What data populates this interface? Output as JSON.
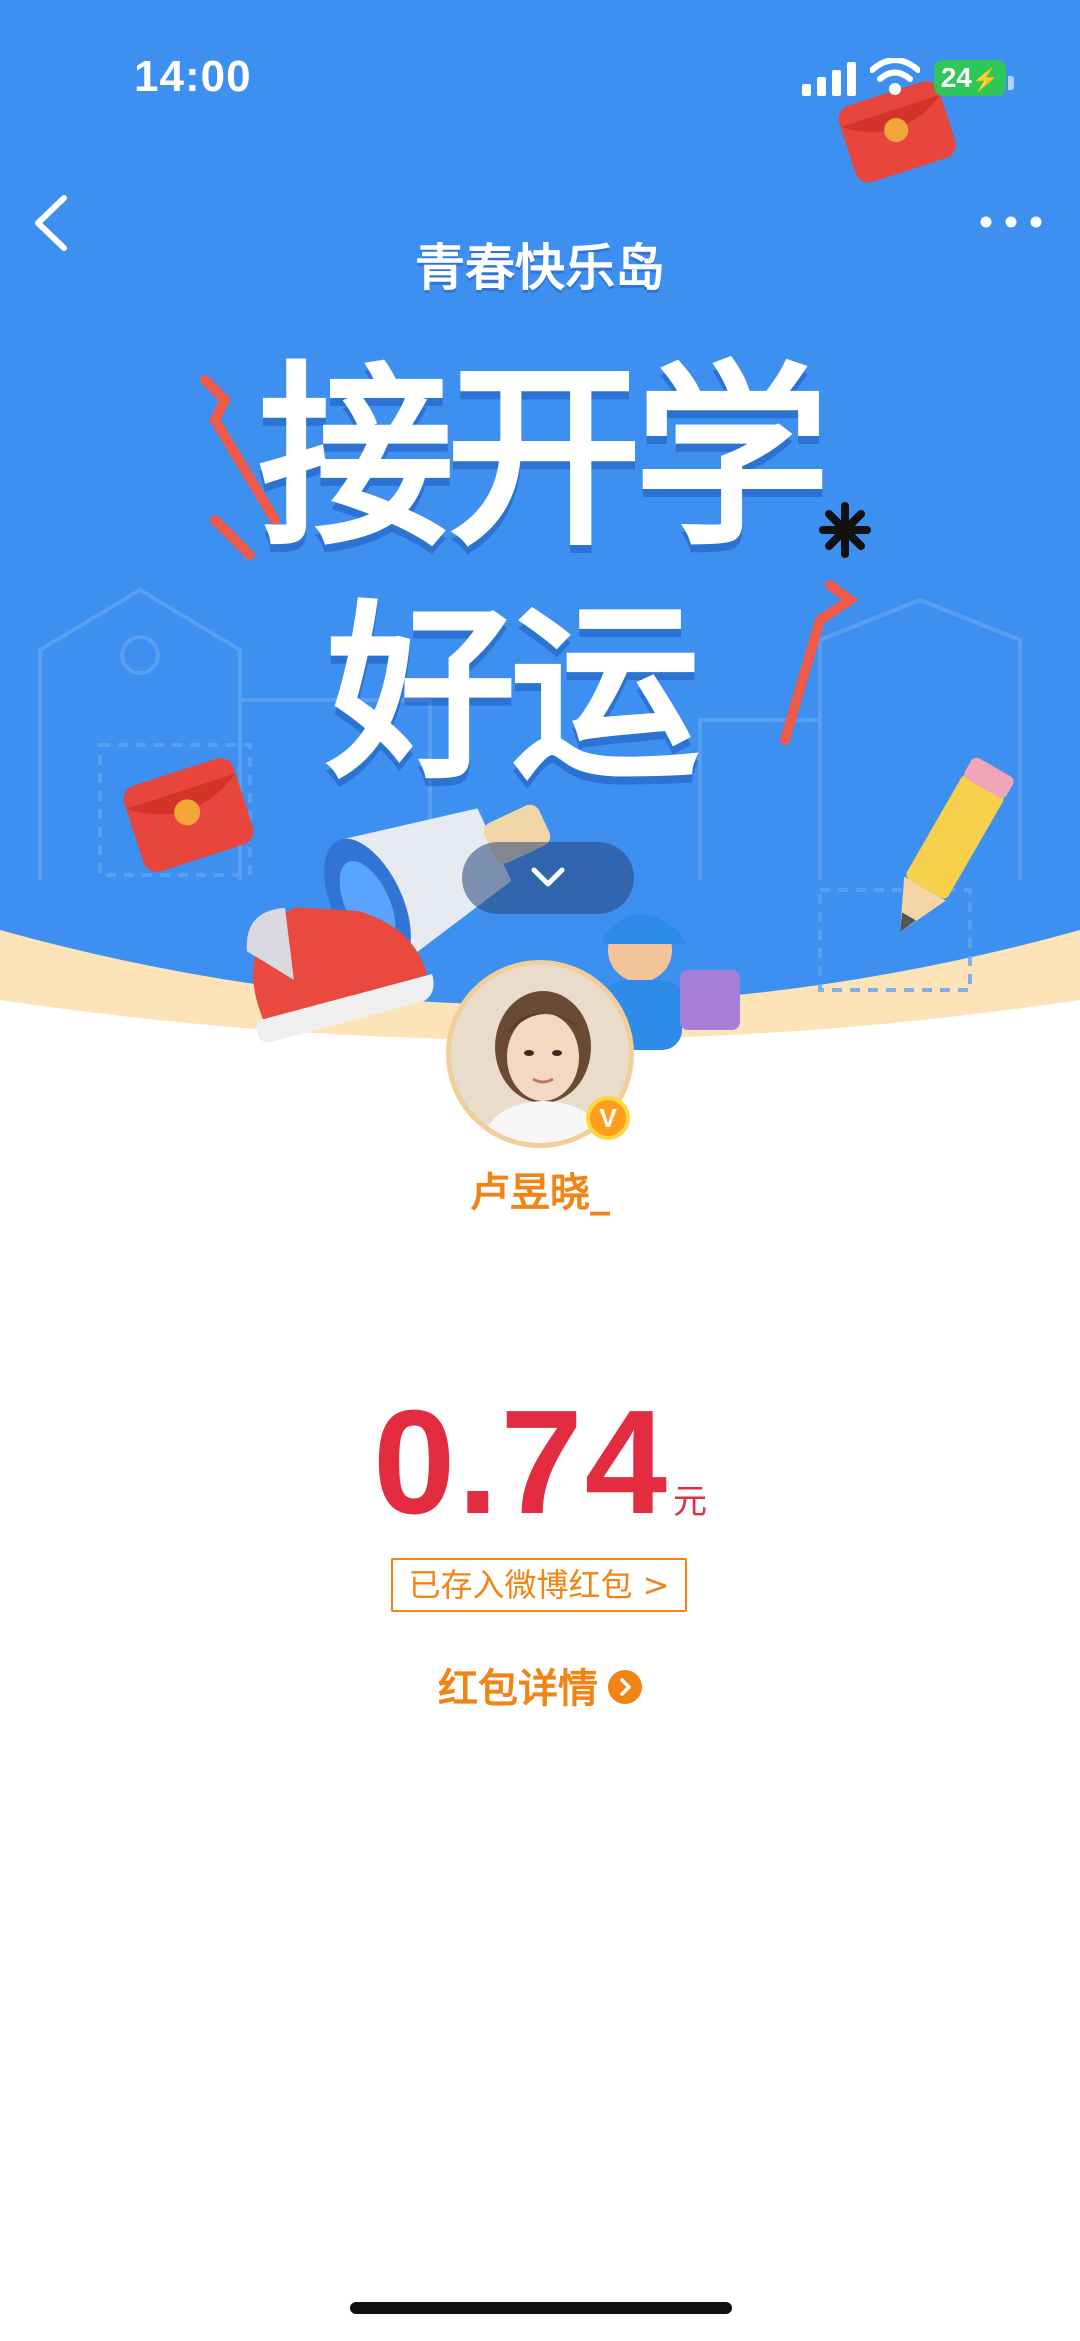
{
  "status_bar": {
    "time": "14:00",
    "battery": "24"
  },
  "nav": {
    "back_icon": "chevron-left-icon",
    "more_icon": "more-dots-icon"
  },
  "banner": {
    "brand": "青春快乐岛",
    "headline_line1": "接开学",
    "headline_line2": "好运",
    "collapse_icon": "chevron-down-icon",
    "colors": {
      "sky": "#3d8ff0",
      "cream": "#fde3b8"
    }
  },
  "profile": {
    "username": "卢昱晓_",
    "badge": "V"
  },
  "red_packet": {
    "amount": "0.74",
    "unit": "元",
    "saved_label": "已存入微博红包 >",
    "details_label": "红包详情"
  },
  "colors": {
    "amount": "#e32c3f",
    "accent": "#f08516"
  }
}
